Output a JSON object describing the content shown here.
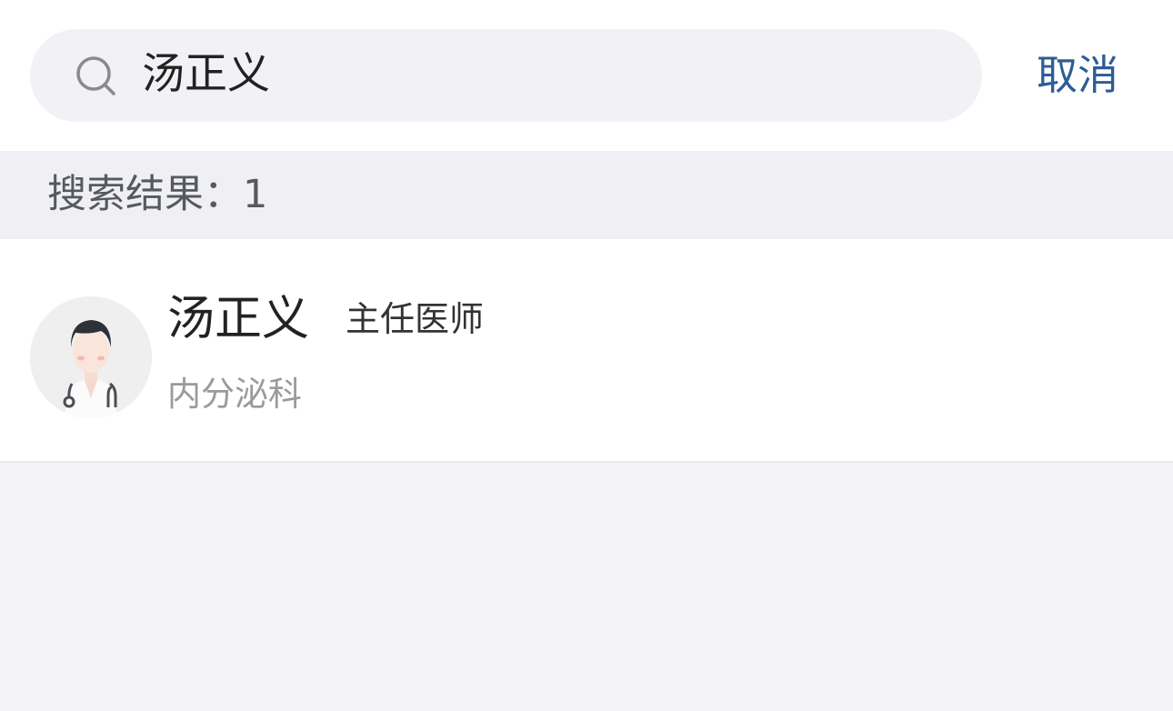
{
  "search": {
    "value": "汤正义",
    "cancel_label": "取消"
  },
  "results": {
    "count_text": "搜索结果：1"
  },
  "doctor": {
    "name": "汤正义",
    "title": "主任医师",
    "department": "内分泌科"
  },
  "icons": {
    "search": "search-icon",
    "avatar": "doctor-avatar-icon"
  },
  "colors": {
    "accent": "#2d5d95",
    "background": "#f2f2f7",
    "search_field": "#f2f2f6"
  }
}
